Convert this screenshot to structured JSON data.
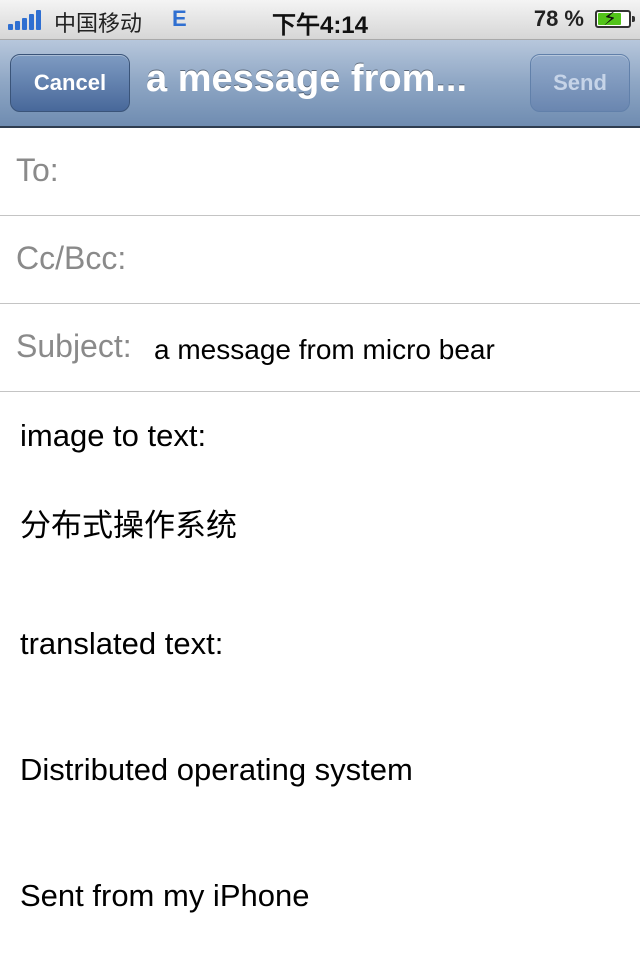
{
  "status_bar": {
    "carrier": "中国移动",
    "network": "E",
    "time": "下午4:14",
    "battery_percent": "78 %",
    "battery_level": 0.78,
    "icons": [
      "signal-bars-icon",
      "battery-charging-icon"
    ]
  },
  "nav": {
    "cancel_label": "Cancel",
    "title": "a message from...",
    "send_label": "Send"
  },
  "fields": {
    "to_label": "To:",
    "to_value": "",
    "ccbcc_label": "Cc/Bcc:",
    "ccbcc_value": "",
    "subject_label": "Subject:",
    "subject_value": "a message from micro bear"
  },
  "body": {
    "line1": "image to text:",
    "line2": "分布式操作系统",
    "line3": "translated text:",
    "line4": "Distributed operating system",
    "signature": "Sent from my iPhone"
  },
  "colors": {
    "nav_bar": "#8ea6c4",
    "button": "#48689a",
    "label_gray": "#8a8a8a",
    "network_blue": "#2f6fd1",
    "battery_green": "#52c41a"
  }
}
